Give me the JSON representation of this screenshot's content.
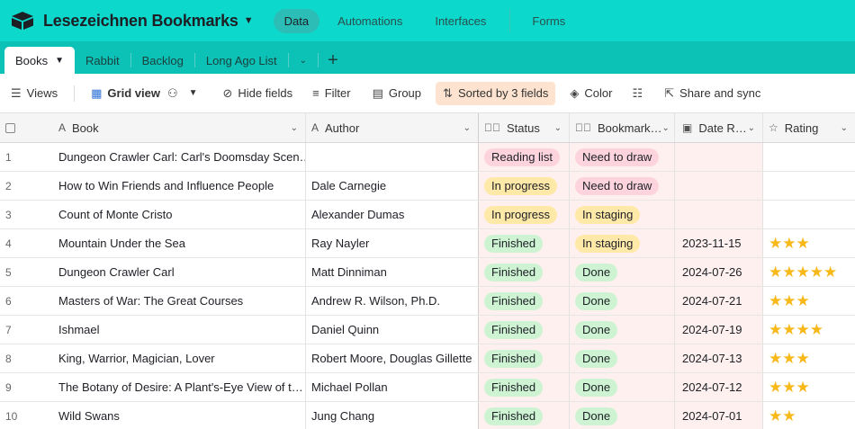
{
  "app": {
    "title": "Lesezeichnen Bookmarks",
    "nav": {
      "data": "Data",
      "automations": "Automations",
      "interfaces": "Interfaces",
      "forms": "Forms"
    },
    "accent": "#0dd8cc"
  },
  "tabs": {
    "active": "Books",
    "others": [
      "Rabbit",
      "Backlog",
      "Long Ago List"
    ]
  },
  "toolbar": {
    "views": "Views",
    "grid_view": "Grid view",
    "hide_fields": "Hide fields",
    "filter": "Filter",
    "group": "Group",
    "sorted": "Sorted by 3 fields",
    "color": "Color",
    "share": "Share and sync"
  },
  "columns": {
    "book": "Book",
    "author": "Author",
    "status": "Status",
    "bookmark": "Bookmark…",
    "date": "Date R…",
    "rating": "Rating"
  },
  "rows": [
    {
      "n": "1",
      "book": "Dungeon Crawler Carl: Carl's Doomsday Scen…",
      "author": "",
      "status": "Reading list",
      "bookmark": "Need to draw",
      "date": "",
      "stars": ""
    },
    {
      "n": "2",
      "book": "How to Win Friends and Influence People",
      "author": "Dale Carnegie",
      "status": "In progress",
      "bookmark": "Need to draw",
      "date": "",
      "stars": ""
    },
    {
      "n": "3",
      "book": "Count of Monte Cristo",
      "author": "Alexander Dumas",
      "status": "In progress",
      "bookmark": "In staging",
      "date": "",
      "stars": ""
    },
    {
      "n": "4",
      "book": "Mountain Under the Sea",
      "author": "Ray Nayler",
      "status": "Finished",
      "bookmark": "In staging",
      "date": "2023-11-15",
      "stars": "★★★"
    },
    {
      "n": "5",
      "book": "Dungeon Crawler Carl",
      "author": "Matt Dinniman",
      "status": "Finished",
      "bookmark": "Done",
      "date": "2024-07-26",
      "stars": "★★★★★"
    },
    {
      "n": "6",
      "book": "Masters of War: The Great Courses",
      "author": "Andrew R. Wilson, Ph.D.",
      "status": "Finished",
      "bookmark": "Done",
      "date": "2024-07-21",
      "stars": "★★★"
    },
    {
      "n": "7",
      "book": "Ishmael",
      "author": "Daniel Quinn",
      "status": "Finished",
      "bookmark": "Done",
      "date": "2024-07-19",
      "stars": "★★★★"
    },
    {
      "n": "8",
      "book": "King, Warrior, Magician, Lover",
      "author": "Robert Moore, Douglas Gillette",
      "status": "Finished",
      "bookmark": "Done",
      "date": "2024-07-13",
      "stars": "★★★"
    },
    {
      "n": "9",
      "book": "The Botany of Desire: A Plant's-Eye View of t…",
      "author": "Michael Pollan",
      "status": "Finished",
      "bookmark": "Done",
      "date": "2024-07-12",
      "stars": "★★★"
    },
    {
      "n": "10",
      "book": "Wild Swans",
      "author": "Jung Chang",
      "status": "Finished",
      "bookmark": "Done",
      "date": "2024-07-01",
      "stars": "★★"
    }
  ]
}
